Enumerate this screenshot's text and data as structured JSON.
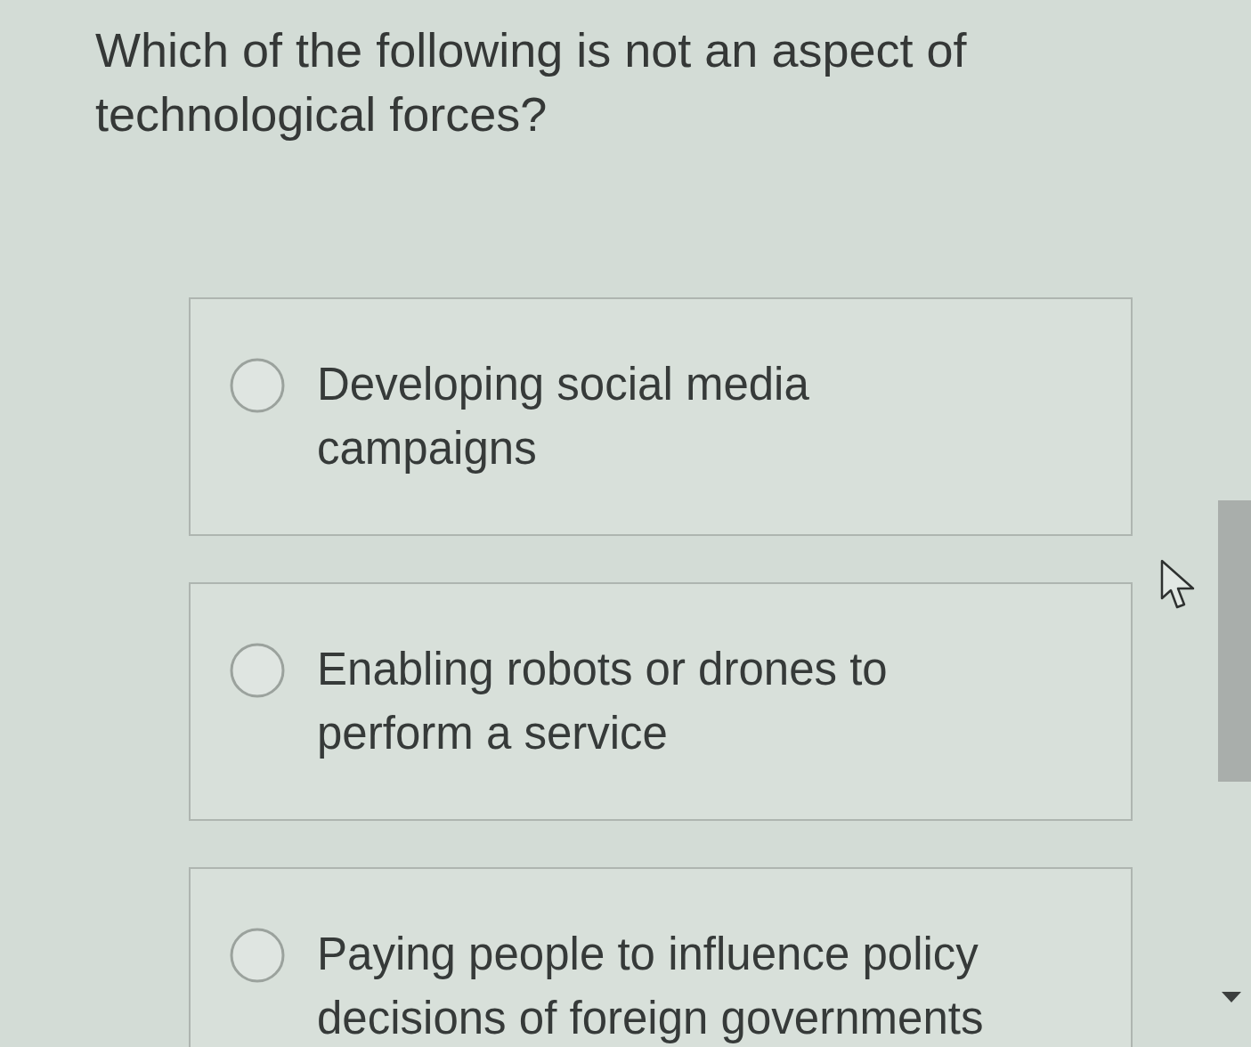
{
  "question": {
    "text": "Which of the following is not an aspect of technological forces?"
  },
  "options": [
    {
      "label": "Developing social media campaigns",
      "selected": false
    },
    {
      "label": "Enabling robots or drones to perform a service",
      "selected": false
    },
    {
      "label": "Paying people to influence policy decisions of foreign governments",
      "selected": false
    }
  ]
}
